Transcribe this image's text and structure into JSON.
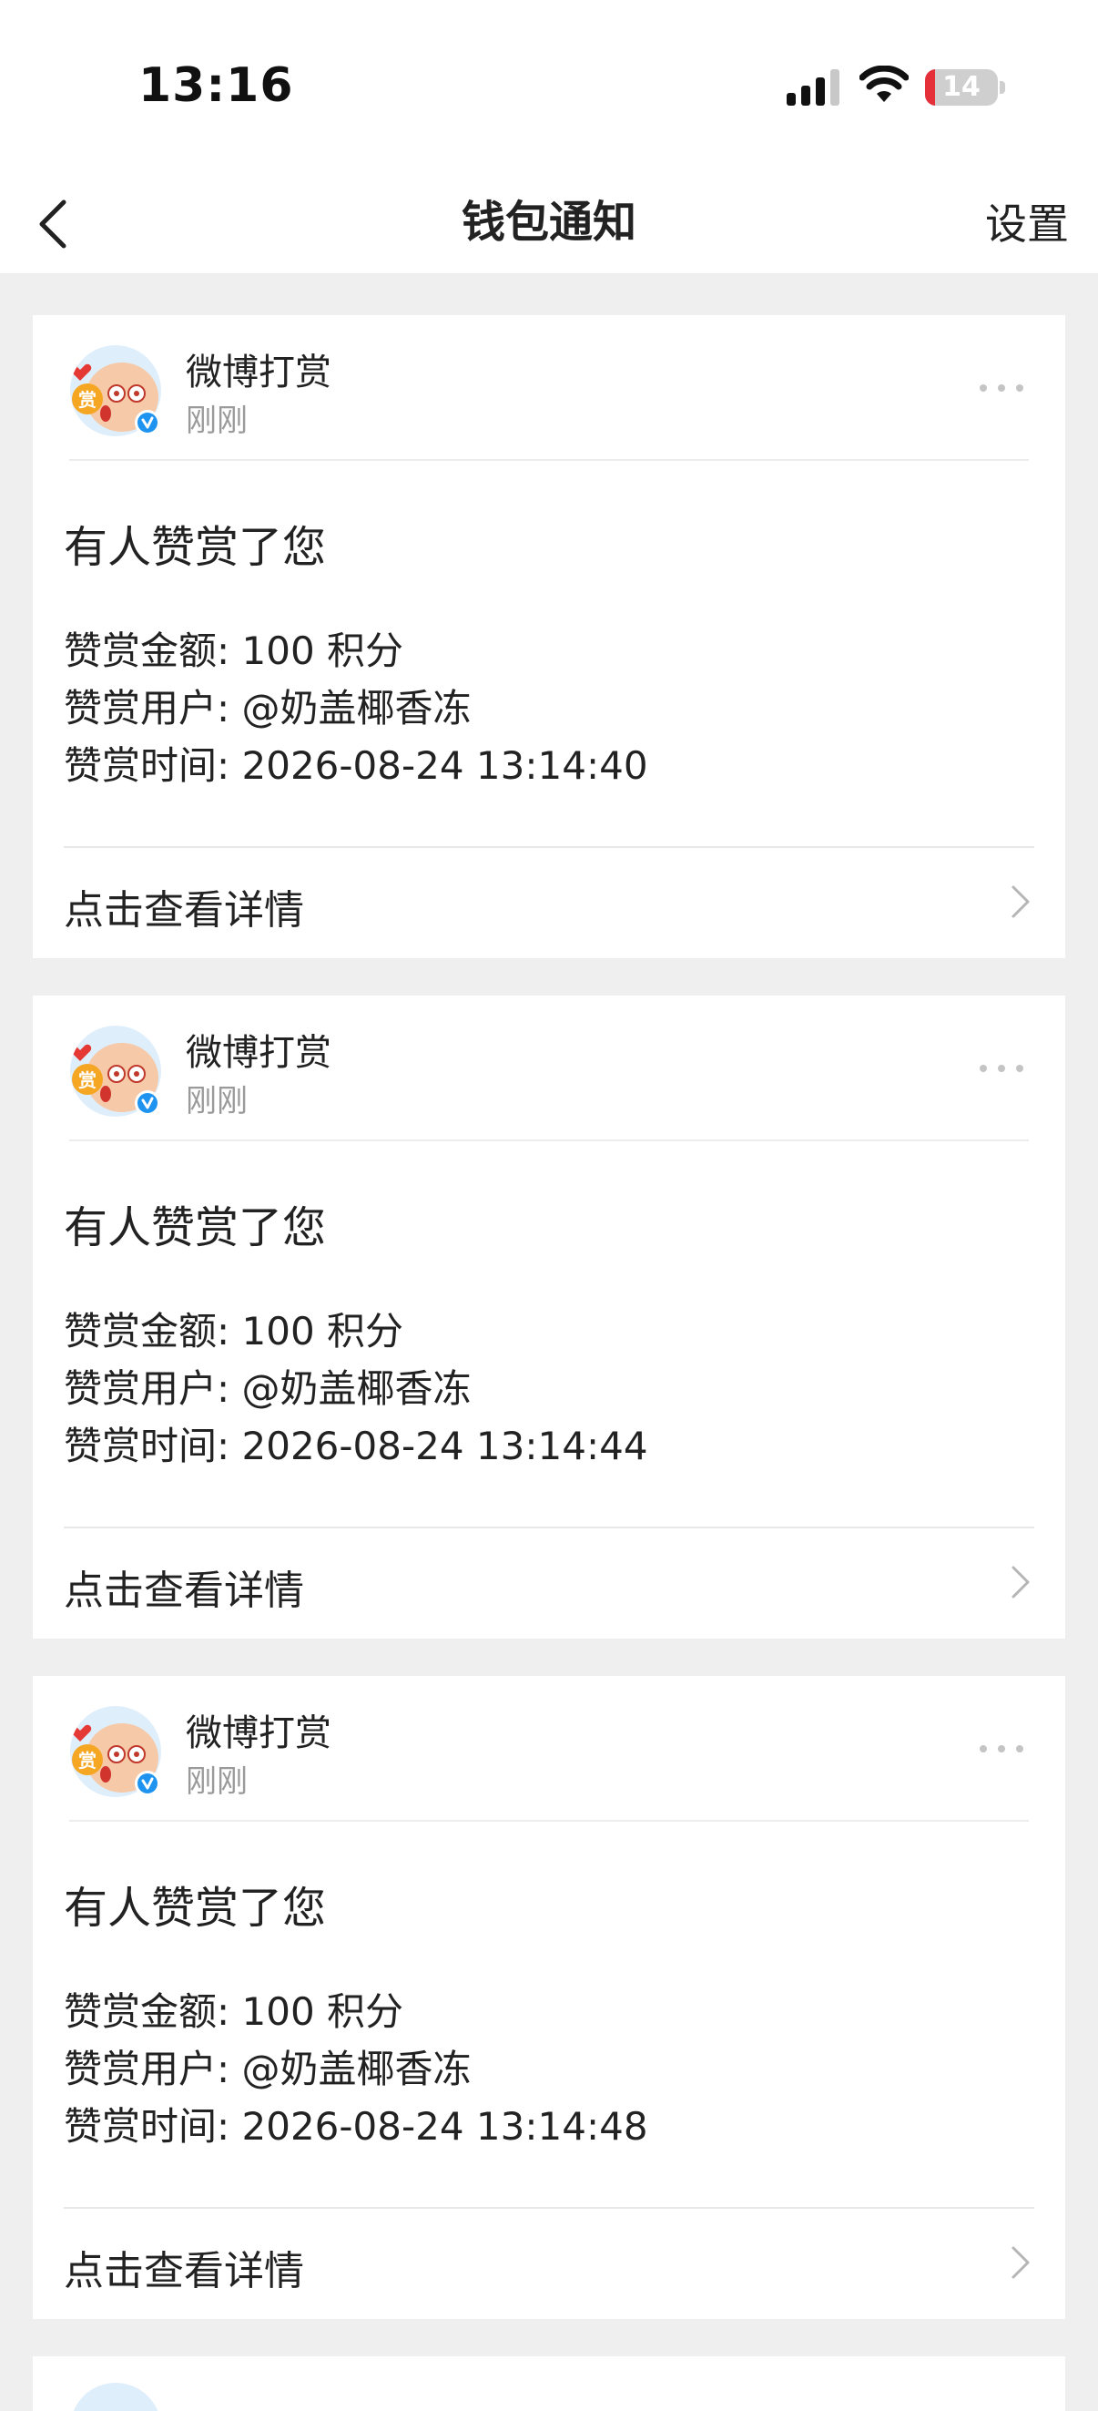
{
  "status_bar": {
    "time": "13:16",
    "battery_level": "14",
    "battery_fraction": 0.14,
    "icons": [
      "cellular-signal-icon",
      "wifi-icon",
      "battery-icon"
    ]
  },
  "nav": {
    "title": "钱包通知",
    "settings_label": "设置",
    "back_icon": "chevron-left-icon"
  },
  "colors": {
    "background": "#efefef",
    "card": "#ffffff",
    "text": "#222222",
    "muted": "#9a9a9a",
    "verified_badge": "#1e94f0",
    "battery_low": "#e5303a"
  },
  "cards": [
    {
      "sender": "微博打赏",
      "time": "刚刚",
      "title": "有人赞赏了您",
      "amount_line": "赞赏金额: 100 积分",
      "user_line": "赞赏用户: @奶盖椰香冻",
      "time_line": "赞赏时间: 2026-08-24 13:14:40",
      "footer": "点击查看详情"
    },
    {
      "sender": "微博打赏",
      "time": "刚刚",
      "title": "有人赞赏了您",
      "amount_line": "赞赏金额: 100 积分",
      "user_line": "赞赏用户: @奶盖椰香冻",
      "time_line": "赞赏时间: 2026-08-24 13:14:44",
      "footer": "点击查看详情"
    },
    {
      "sender": "微博打赏",
      "time": "刚刚",
      "title": "有人赞赏了您",
      "amount_line": "赞赏金额: 100 积分",
      "user_line": "赞赏用户: @奶盖椰香冻",
      "time_line": "赞赏时间: 2026-08-24 13:14:48",
      "footer": "点击查看详情"
    }
  ]
}
